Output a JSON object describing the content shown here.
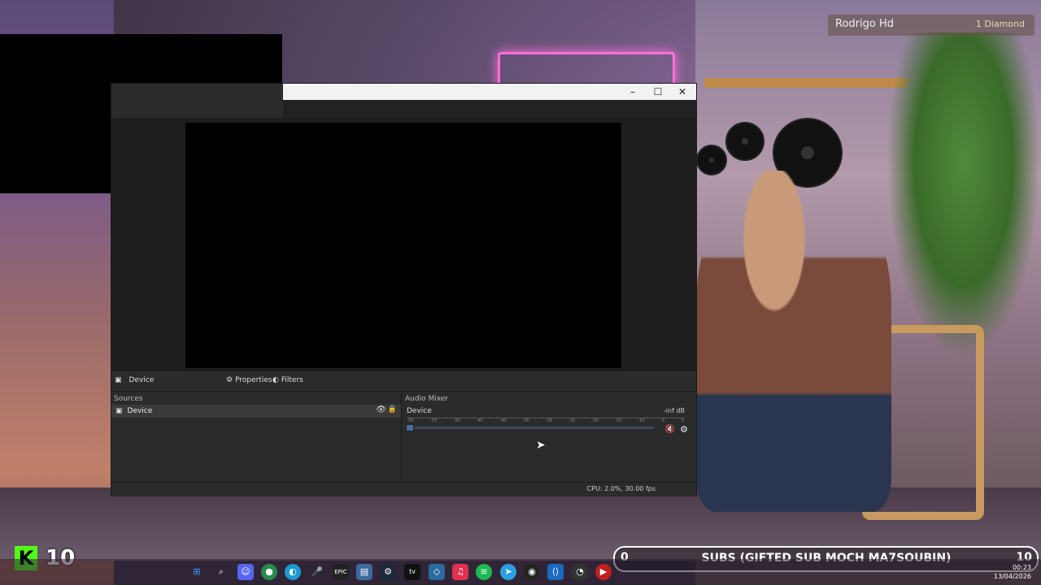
{
  "viewer": {
    "name": "Rodrigo Hd",
    "diamond": "1 Diamond"
  },
  "obs": {
    "window_controls": {
      "minimize": "–",
      "maximize": "☐",
      "close": "✕"
    },
    "scene_strip": {
      "source_name": "Device",
      "properties_label": "Properties",
      "filters_label": "Filters"
    },
    "sources": {
      "title": "Sources",
      "items": [
        {
          "label": "Device"
        }
      ]
    },
    "mixer": {
      "title": "Audio Mixer",
      "device": "Device",
      "level": "-inf dB",
      "ticks": [
        "-60",
        "-55",
        "-50",
        "-45",
        "-40",
        "-35",
        "-30",
        "-25",
        "-20",
        "-15",
        "-10",
        "-5",
        "0"
      ]
    },
    "status": "CPU: 2.0%, 30.00 fps"
  },
  "overlay": {
    "kick_logo": "K",
    "kick_count": "10",
    "subs": {
      "left": "0",
      "label": "SUBS (GIFTED SUB MOCH MA7SOUBIN)",
      "right": "10"
    }
  },
  "taskbar": {
    "icons": [
      "windows-start-icon",
      "search-icon",
      "discord-icon",
      "chrome-icon",
      "edge-icon",
      "microphone-icon",
      "epic-games-icon",
      "store-icon",
      "steam-icon",
      "apple-tv-icon",
      "app-icon",
      "music-icon",
      "spotify-icon",
      "telegram-icon",
      "obs-icon",
      "vscode-icon",
      "speedometer-icon",
      "media-icon"
    ],
    "time": "00:23",
    "date": "13/04/2026"
  },
  "colors": {
    "kick_green": "#53fc18",
    "obs_panel": "#2b2b2b"
  }
}
